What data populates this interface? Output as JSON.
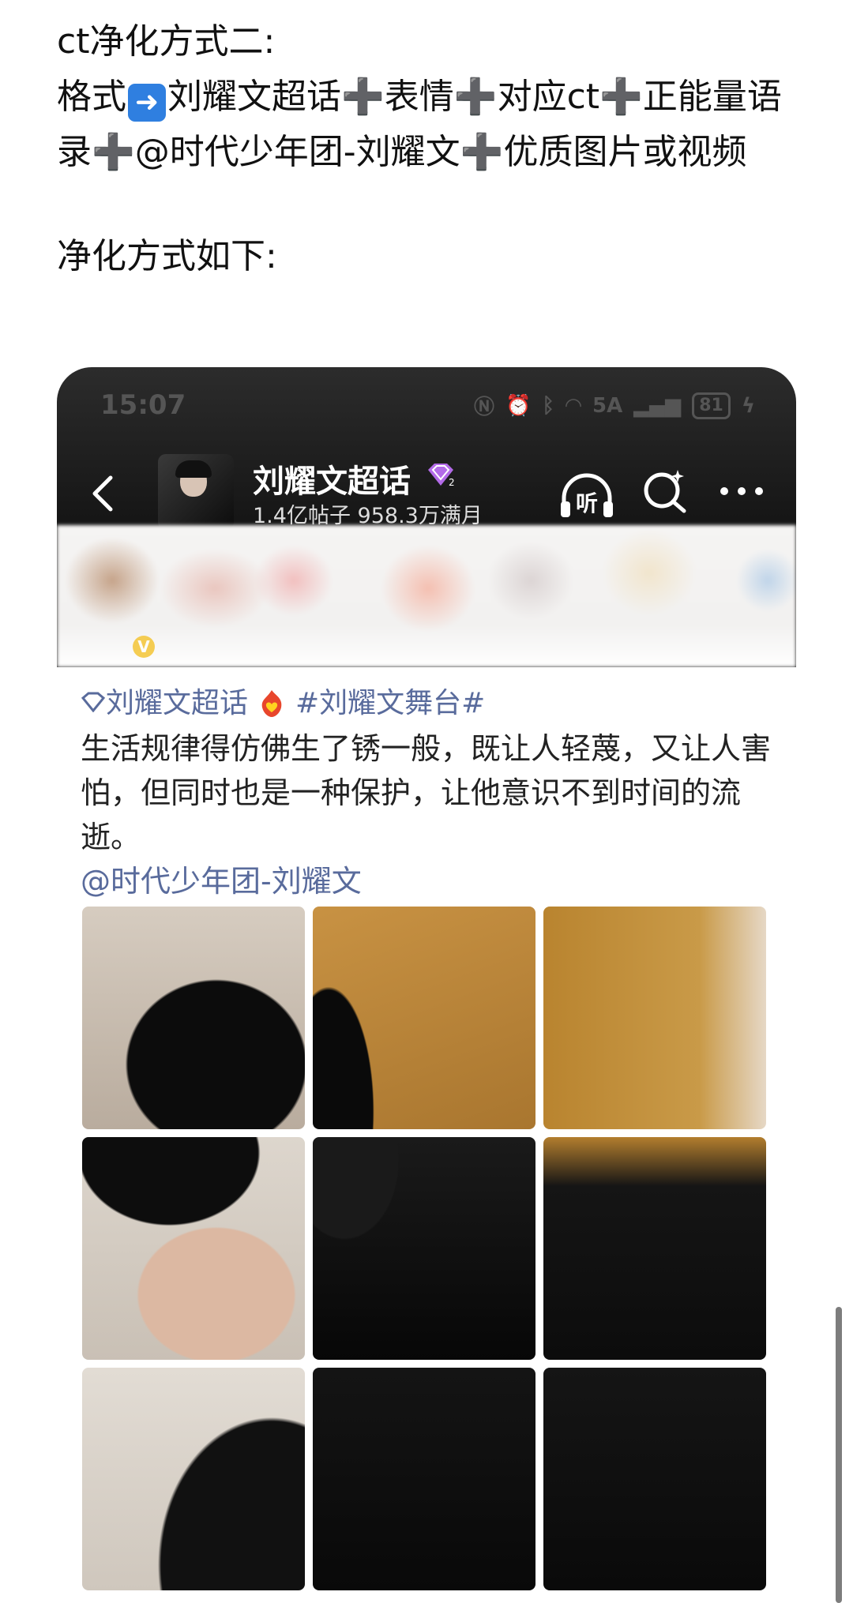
{
  "article": {
    "heading": "ct净化方式二:",
    "format_label": "格式",
    "arrow_icon": "right-arrow-emoji",
    "format_parts": [
      "刘耀文超话",
      "表情",
      "对应ct",
      "正能量语录",
      "@时代少年团-刘耀文",
      "优质图片或视频"
    ],
    "plus": "➕",
    "section_title": "净化方式如下:"
  },
  "screenshot": {
    "status_bar": {
      "time": "15:07",
      "battery": "81",
      "network": "5A"
    },
    "topic": {
      "name": "刘耀文超话",
      "badge_level": "2",
      "posts": "1.4亿帖子",
      "members": "958.3万满月"
    },
    "header_icons": {
      "listen_label": "听"
    },
    "post": {
      "topic_tag": "刘耀文超话",
      "hashtag": "#刘耀文舞台#",
      "text": "生活规律得仿佛生了锈一般，既让人轻蔑，又让人害怕，但同时也是一种保护，让他意识不到时间的流逝。",
      "mention": "@时代少年团-刘耀文",
      "image_count": 9
    },
    "colors": {
      "link": "#596b9c",
      "badge": "#b36be8",
      "header_bg": "#141414"
    }
  }
}
